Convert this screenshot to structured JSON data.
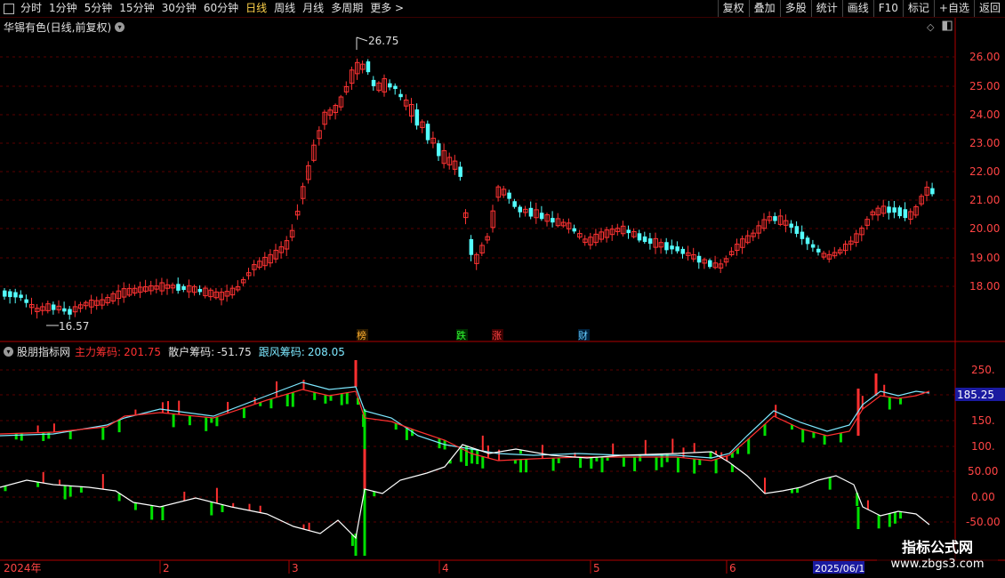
{
  "toolbar": {
    "periods": [
      "分时",
      "1分钟",
      "5分钟",
      "15分钟",
      "30分钟",
      "60分钟",
      "日线",
      "周线",
      "月线",
      "多周期",
      "更多 >"
    ],
    "active_period": "日线",
    "right_buttons": [
      "复权",
      "叠加",
      "多股",
      "统计",
      "画线",
      "F10",
      "标记",
      "+自选",
      "返回"
    ]
  },
  "main_panel": {
    "title": "华锡有色(日线,前复权)",
    "price_axis": [
      "26.00",
      "25.00",
      "24.00",
      "23.00",
      "22.00",
      "21.00",
      "20.00",
      "19.00",
      "18.00"
    ],
    "high_label": "26.75",
    "low_label": "16.57",
    "event_markers": [
      "榜",
      "跌",
      "涨",
      "财"
    ],
    "colors": {
      "up": "#ff3333",
      "down": "#54ffff",
      "grid": "#5a0000",
      "axis": "#ff4444"
    }
  },
  "indicator_panel": {
    "name": "股朋指标网",
    "main_label": "主力筹码:",
    "main_value": "201.75",
    "retail_label": "散户筹码:",
    "retail_value": "-51.75",
    "follow_label": "跟风筹码:",
    "follow_value": "208.05",
    "axis": [
      "250.",
      "200.",
      "150.",
      "100.",
      "50.00",
      "0.00",
      "-50.00"
    ],
    "current_tag": "185.25",
    "colors": {
      "main": "#ff3030",
      "retail": "#ffffff",
      "follow": "#7de8ff",
      "green": "#00e000"
    }
  },
  "date_axis": {
    "labels": [
      "2024年",
      "2",
      "3",
      "4",
      "5",
      "6",
      "2025/06/1"
    ]
  },
  "watermark": {
    "line1": "指标公式网",
    "line2": "www.zbgs3.com"
  }
}
